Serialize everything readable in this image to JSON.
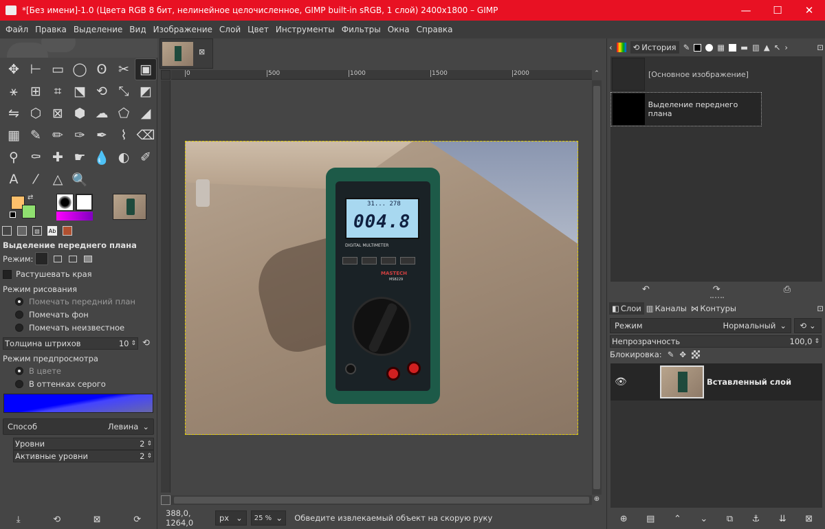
{
  "window": {
    "title": "*[Без имени]-1.0 (Цвета RGB 8 бит, нелинейное целочисленное, GIMP built-in sRGB, 1 слой) 2400x1800 – GIMP",
    "min": "—",
    "max": "☐",
    "close": "✕"
  },
  "menu": [
    "Файл",
    "Правка",
    "Выделение",
    "Вид",
    "Изображение",
    "Слой",
    "Цвет",
    "Инструменты",
    "Фильтры",
    "Окна",
    "Справка"
  ],
  "toolbox": {
    "tools": [
      {
        "name": "move-tool-icon",
        "glyph": "✥"
      },
      {
        "name": "align-tool-icon",
        "glyph": "⊢"
      },
      {
        "name": "rect-select-icon",
        "glyph": "▭"
      },
      {
        "name": "ellipse-select-icon",
        "glyph": "◯"
      },
      {
        "name": "free-select-icon",
        "glyph": "ʘ"
      },
      {
        "name": "scissors-select-icon",
        "glyph": "✂"
      },
      {
        "name": "foreground-select-icon",
        "glyph": "▣",
        "selected": true
      },
      {
        "name": "fuzzy-select-icon",
        "glyph": "⚹"
      },
      {
        "name": "color-select-icon",
        "glyph": "⊞"
      },
      {
        "name": "crop-tool-icon",
        "glyph": "⌗"
      },
      {
        "name": "unified-transform-icon",
        "glyph": "⬔"
      },
      {
        "name": "rotate-tool-icon",
        "glyph": "⟲"
      },
      {
        "name": "scale-tool-icon",
        "glyph": "⤡"
      },
      {
        "name": "shear-tool-icon",
        "glyph": "◩"
      },
      {
        "name": "flip-tool-icon",
        "glyph": "⇋"
      },
      {
        "name": "perspective-tool-icon",
        "glyph": "⬡"
      },
      {
        "name": "grid-transform-icon",
        "glyph": "⊠"
      },
      {
        "name": "handle-transform-icon",
        "glyph": "⬢"
      },
      {
        "name": "warp-transform-icon",
        "glyph": "☁"
      },
      {
        "name": "cage-transform-icon",
        "glyph": "⬠"
      },
      {
        "name": "bucket-fill-icon",
        "glyph": "◢"
      },
      {
        "name": "gradient-tool-icon",
        "glyph": "▦"
      },
      {
        "name": "paintbrush-icon",
        "glyph": "✎"
      },
      {
        "name": "pencil-icon",
        "glyph": "✏"
      },
      {
        "name": "airbrush-icon",
        "glyph": "✑"
      },
      {
        "name": "ink-tool-icon",
        "glyph": "✒"
      },
      {
        "name": "mypaint-brush-icon",
        "glyph": "⌇"
      },
      {
        "name": "eraser-icon",
        "glyph": "⌫"
      },
      {
        "name": "clone-tool-icon",
        "glyph": "⚲"
      },
      {
        "name": "perspective-clone-icon",
        "glyph": "⚰"
      },
      {
        "name": "heal-tool-icon",
        "glyph": "✚"
      },
      {
        "name": "smudge-tool-icon",
        "glyph": "☛"
      },
      {
        "name": "blur-tool-icon",
        "glyph": "💧"
      },
      {
        "name": "dodge-burn-icon",
        "glyph": "◐"
      },
      {
        "name": "paths-tool-icon",
        "glyph": "✐"
      },
      {
        "name": "text-tool-icon",
        "glyph": "A"
      },
      {
        "name": "color-picker-icon",
        "glyph": "⁄"
      },
      {
        "name": "measure-tool-icon",
        "glyph": "△"
      },
      {
        "name": "zoom-tool-icon",
        "glyph": "🔍"
      }
    ],
    "fg_color": "#fdc06b",
    "bg_color": "#90e070"
  },
  "tool_options": {
    "title": "Выделение переднего плана",
    "mode_label": "Режим:",
    "feather": "Растушевать края",
    "draw_mode_label": "Режим рисования",
    "draw_modes": [
      "Помечать передний план",
      "Помечать фон",
      "Помечать неизвестное"
    ],
    "stroke_label": "Толщина штрихов",
    "stroke_value": "10",
    "preview_label": "Режим предпросмотра",
    "preview_modes": [
      "В цвете",
      "В оттенках серого"
    ],
    "method_label": "Способ",
    "method_value": "Левина",
    "levels_label": "Уровни",
    "levels_value": "2",
    "active_levels_label": "Активные уровни",
    "active_levels_value": "2"
  },
  "canvas": {
    "ruler_marks": [
      "0",
      "500",
      "1000",
      "1500",
      "2000"
    ],
    "coords": "388,0, 1264,0",
    "unit": "px",
    "zoom": "25 %",
    "status": "Обведите извлекаемый объект на скорую руку",
    "lcd_top": "31... 278",
    "lcd_main": "004.8",
    "meter_label": "DIGITAL MULTIMETER",
    "meter_brand": "MASTECH",
    "meter_model": "MS8229"
  },
  "history": {
    "tab_label": "История",
    "items": [
      "[Основное изображение]",
      "Выделение переднего плана"
    ]
  },
  "layers": {
    "tabs": [
      "Слои",
      "Каналы",
      "Контуры"
    ],
    "mode_label": "Режим",
    "mode_value": "Нормальный",
    "opacity_label": "Непрозрачность",
    "opacity_value": "100,0",
    "lock_label": "Блокировка:",
    "layer_name": "Вставленный слой"
  }
}
